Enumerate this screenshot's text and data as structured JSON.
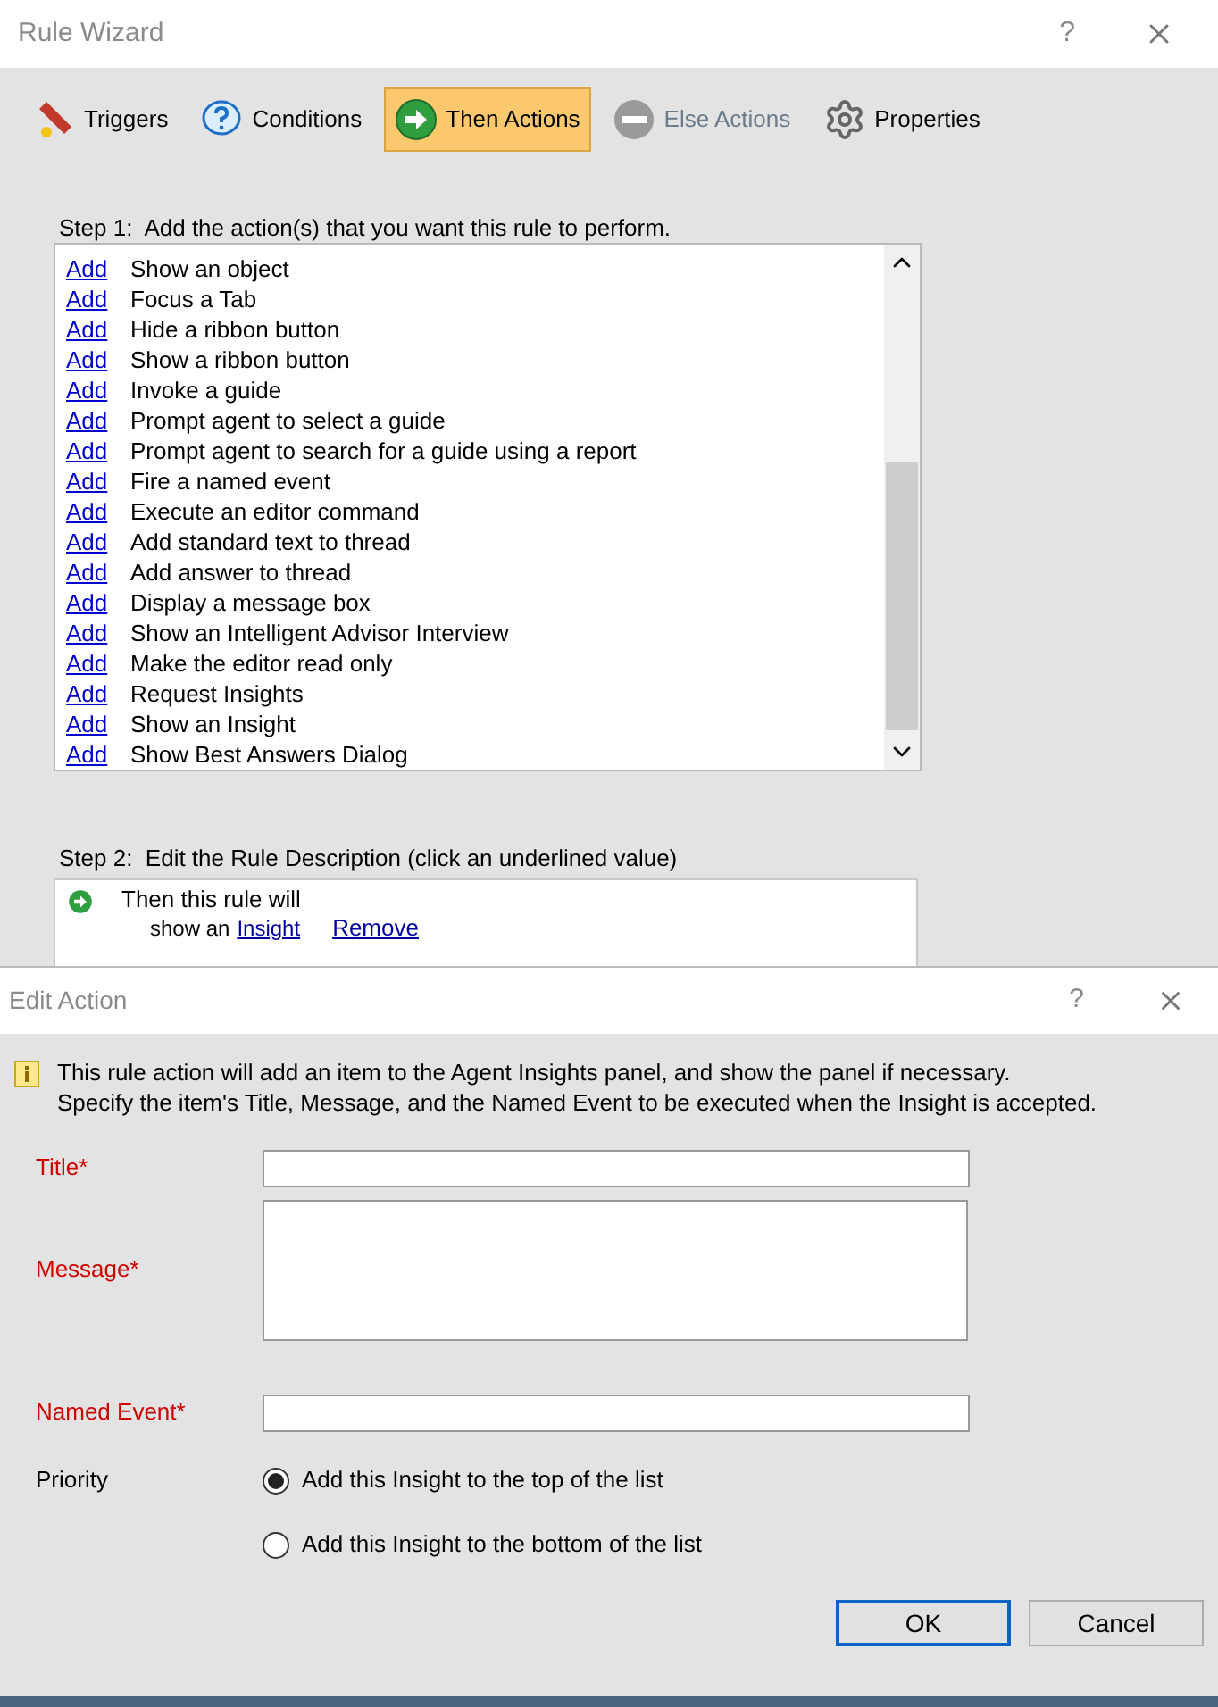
{
  "rule_wizard": {
    "title": "Rule Wizard",
    "help": "?",
    "tabs": [
      {
        "kind": "triggers",
        "label": "Triggers",
        "selected": false,
        "disabled": false
      },
      {
        "kind": "conditions",
        "label": "Conditions",
        "selected": false,
        "disabled": false
      },
      {
        "kind": "then",
        "label": "Then Actions",
        "selected": true,
        "disabled": false
      },
      {
        "kind": "else",
        "label": "Else Actions",
        "selected": false,
        "disabled": true
      },
      {
        "kind": "properties",
        "label": "Properties",
        "selected": false,
        "disabled": false
      }
    ],
    "step1": "Step 1:  Add the action(s) that you want this rule to perform.",
    "actions": [
      {
        "link": "Add",
        "label": "Show an object"
      },
      {
        "link": "Add",
        "label": "Focus a Tab"
      },
      {
        "link": "Add",
        "label": "Hide a ribbon button"
      },
      {
        "link": "Add",
        "label": "Show a ribbon button"
      },
      {
        "link": "Add",
        "label": "Invoke a guide"
      },
      {
        "link": "Add",
        "label": "Prompt agent to select a guide"
      },
      {
        "link": "Add",
        "label": "Prompt agent to search for a guide using a report"
      },
      {
        "link": "Add",
        "label": "Fire a named event"
      },
      {
        "link": "Add",
        "label": "Execute an editor command"
      },
      {
        "link": "Add",
        "label": "Add standard text to thread"
      },
      {
        "link": "Add",
        "label": "Add answer to thread"
      },
      {
        "link": "Add",
        "label": "Display a message box"
      },
      {
        "link": "Add",
        "label": "Show an Intelligent Advisor Interview"
      },
      {
        "link": "Add",
        "label": "Make the editor read only"
      },
      {
        "link": "Add",
        "label": "Request Insights"
      },
      {
        "link": "Add",
        "label": "Show an Insight"
      },
      {
        "link": "Add",
        "label": "Show Best Answers Dialog"
      }
    ],
    "step2": "Step 2:  Edit the Rule Description (click an underlined value)",
    "description": {
      "line1": "Then this rule will",
      "prefix": "show an",
      "value": "Insight",
      "remove": "Remove"
    }
  },
  "edit_action": {
    "title": "Edit Action",
    "help": "?",
    "info": [
      "This rule action will add an item to the Agent Insights panel, and show the panel if necessary.",
      "Specify the item's Title, Message, and the Named Event to be executed when the Insight is accepted."
    ],
    "fields": [
      {
        "kind": "line",
        "label": "Title*",
        "required": true
      },
      {
        "kind": "area",
        "label": "Message*",
        "required": true
      },
      {
        "kind": "line",
        "label": "Named Event*",
        "required": true
      }
    ],
    "priority": {
      "label": "Priority",
      "options": [
        {
          "label": "Add this Insight to the top of the list",
          "selected": true
        },
        {
          "label": "Add this Insight to the bottom of the list",
          "selected": false
        }
      ]
    },
    "buttons": [
      {
        "label": "OK",
        "default": true
      },
      {
        "label": "Cancel",
        "default": false
      }
    ]
  }
}
